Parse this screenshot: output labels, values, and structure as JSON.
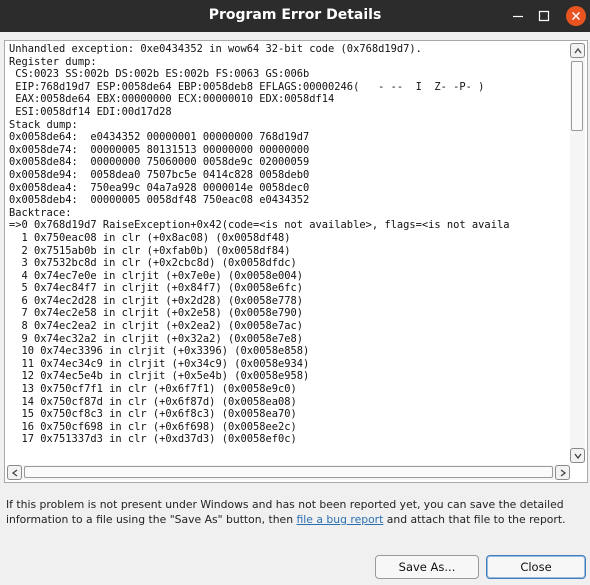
{
  "window": {
    "title": "Program Error Details",
    "controls": [
      "minimize-icon",
      "maximize-icon",
      "close-icon"
    ],
    "close_button_color": "#e95420"
  },
  "log": {
    "lines": [
      "Unhandled exception: 0xe0434352 in wow64 32-bit code (0x768d19d7).",
      "Register dump:",
      " CS:0023 SS:002b DS:002b ES:002b FS:0063 GS:006b",
      " EIP:768d19d7 ESP:0058de64 EBP:0058deb8 EFLAGS:00000246(   - --  I  Z- -P- )",
      " EAX:0058de64 EBX:00000000 ECX:00000010 EDX:0058df14",
      " ESI:0058df14 EDI:00d17d28",
      "Stack dump:",
      "0x0058de64:  e0434352 00000001 00000000 768d19d7",
      "0x0058de74:  00000005 80131513 00000000 00000000",
      "0x0058de84:  00000000 75060000 0058de9c 02000059",
      "0x0058de94:  0058dea0 7507bc5e 0414c828 0058deb0",
      "0x0058dea4:  750ea99c 04a7a928 0000014e 0058dec0",
      "0x0058deb4:  00000005 0058df48 750eac08 e0434352",
      "Backtrace:",
      "=>0 0x768d19d7 RaiseException+0x42(code=<is not available>, flags=<is not availa",
      "  1 0x750eac08 in clr (+0x8ac08) (0x0058df48)",
      "  2 0x7515ab0b in clr (+0xfab0b) (0x0058df84)",
      "  3 0x7532bc8d in clr (+0x2cbc8d) (0x0058dfdc)",
      "  4 0x74ec7e0e in clrjit (+0x7e0e) (0x0058e004)",
      "  5 0x74ec84f7 in clrjit (+0x84f7) (0x0058e6fc)",
      "  6 0x74ec2d28 in clrjit (+0x2d28) (0x0058e778)",
      "  7 0x74ec2e58 in clrjit (+0x2e58) (0x0058e790)",
      "  8 0x74ec2ea2 in clrjit (+0x2ea2) (0x0058e7ac)",
      "  9 0x74ec32a2 in clrjit (+0x32a2) (0x0058e7e8)",
      "  10 0x74ec3396 in clrjit (+0x3396) (0x0058e858)",
      "  11 0x74ec34c9 in clrjit (+0x34c9) (0x0058e934)",
      "  12 0x74ec5e4b in clrjit (+0x5e4b) (0x0058e958)",
      "  13 0x750cf7f1 in clr (+0x6f7f1) (0x0058e9c0)",
      "  14 0x750cf87d in clr (+0x6f87d) (0x0058ea08)",
      "  15 0x750cf8c3 in clr (+0x6f8c3) (0x0058ea70)",
      "  16 0x750cf698 in clr (+0x6f698) (0x0058ee2c)",
      "  17 0x751337d3 in clr (+0xd37d3) (0x0058ef0c)"
    ]
  },
  "info": {
    "text_before_link": "If this problem is not present under Windows and has not been reported yet, you can save the detailed information to a file using the \"Save As\" button, then ",
    "link_text": "file a bug report",
    "text_after_link": " and attach that file to the report."
  },
  "buttons": {
    "save_as_label": "Save As...",
    "close_label": "Close"
  }
}
